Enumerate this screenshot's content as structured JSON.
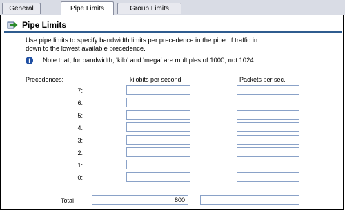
{
  "tabs": [
    {
      "label": "General"
    },
    {
      "label": "Pipe Limits"
    },
    {
      "label": "Group Limits"
    }
  ],
  "section": {
    "title": "Pipe Limits",
    "intro_line1": "Use pipe limits to specify bandwidth limits per precedence in the pipe. If traffic in",
    "intro_line2": "down to the lowest available precedence.",
    "note": "Note that, for bandwidth, 'kilo' and 'mega' are multiples of 1000, not 1024"
  },
  "table": {
    "col_precedences": "Precedences:",
    "col_kbps": "kilobits per second",
    "col_pps": "Packets per sec.",
    "rows": [
      {
        "label": "7:",
        "kbps": "",
        "pps": ""
      },
      {
        "label": "6:",
        "kbps": "",
        "pps": ""
      },
      {
        "label": "5:",
        "kbps": "",
        "pps": ""
      },
      {
        "label": "4:",
        "kbps": "",
        "pps": ""
      },
      {
        "label": "3:",
        "kbps": "",
        "pps": ""
      },
      {
        "label": "2:",
        "kbps": "",
        "pps": ""
      },
      {
        "label": "1:",
        "kbps": "",
        "pps": ""
      },
      {
        "label": "0:",
        "kbps": "",
        "pps": ""
      }
    ],
    "total_label": "Total",
    "total_kbps": "800",
    "total_pps": ""
  },
  "icons": {
    "title_icon": "pipe-arrow-icon",
    "note_icon": "info-icon"
  },
  "colors": {
    "tab_bar": "#d9dce5",
    "title_rule": "#2f5c8f",
    "field_border": "#8aa2c8",
    "info_icon": "#1f4fa3"
  }
}
